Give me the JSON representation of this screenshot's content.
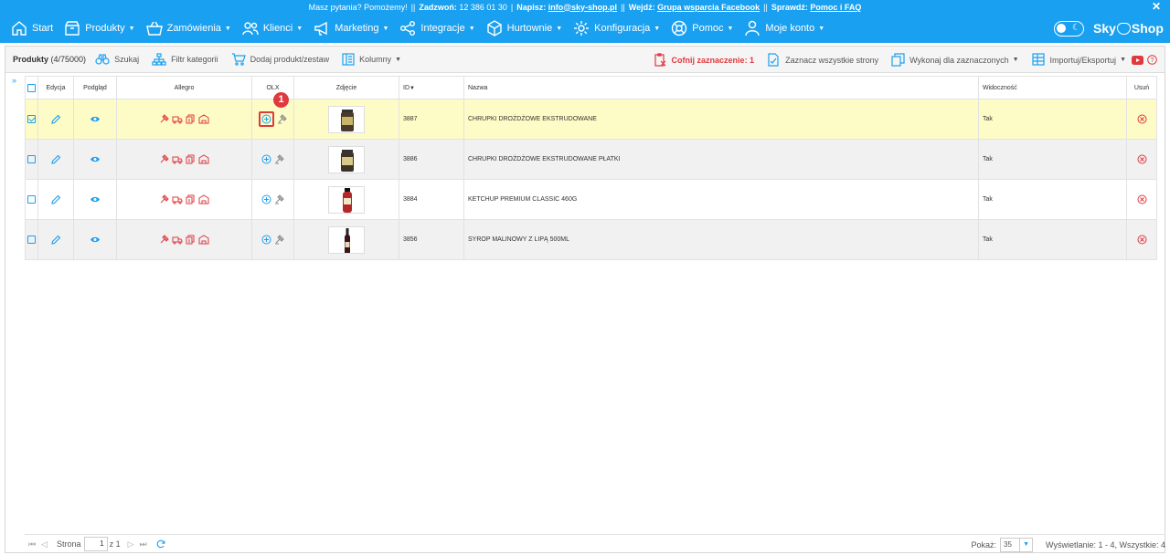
{
  "topbar": {
    "question": "Masz pytania? Pomożemy!",
    "call_label": "Zadzwoń:",
    "call_number": "12 386 01 30",
    "write_label": "Napisz:",
    "email": "info@sky-shop.pl",
    "join_label": "Wejdź:",
    "facebook_link": "Grupa wsparcia Facebook",
    "check_label": "Sprawdź:",
    "help_link": "Pomoc i FAQ",
    "separator": "||"
  },
  "nav": {
    "items": [
      {
        "label": "Start",
        "icon": "home-icon"
      },
      {
        "label": "Produkty",
        "icon": "box-icon"
      },
      {
        "label": "Zamówienia",
        "icon": "basket-icon"
      },
      {
        "label": "Klienci",
        "icon": "users-icon"
      },
      {
        "label": "Marketing",
        "icon": "megaphone-icon"
      },
      {
        "label": "Integracje",
        "icon": "share-icon"
      },
      {
        "label": "Hurtownie",
        "icon": "cube-icon"
      },
      {
        "label": "Konfiguracja",
        "icon": "gear-icon"
      },
      {
        "label": "Pomoc",
        "icon": "lifebuoy-icon"
      },
      {
        "label": "Moje konto",
        "icon": "user-icon"
      }
    ],
    "logo_left": "Sky",
    "logo_right": "Shop"
  },
  "toolbar": {
    "title": "Produkty",
    "count": "(4/75000)",
    "search": "Szukaj",
    "category_filter": "Filtr kategorii",
    "add_product": "Dodaj produkt/zestaw",
    "columns": "Kolumny",
    "undo_selection": "Cofnij zaznaczenie: 1",
    "select_all_pages": "Zaznacz wszystkie strony",
    "do_for_selected": "Wykonaj dla zaznaczonych",
    "import_export": "Importuj/Eksportuj"
  },
  "table": {
    "headers": {
      "edit": "Edycja",
      "preview": "Podgląd",
      "allegro": "Allegro",
      "olx": "OLX",
      "photo": "Zdjęcie",
      "id": "ID",
      "name": "Nazwa",
      "visibility": "Widoczność",
      "delete": "Usuń"
    },
    "rows": [
      {
        "id": "3887",
        "name": "CHRUPKI DROŻDŻOWE EKSTRUDOWANE",
        "visibility": "Tak",
        "selected": true
      },
      {
        "id": "3886",
        "name": "CHRUPKI DROŻDŻOWE EKSTRUDOWANE PŁATKI",
        "visibility": "Tak",
        "selected": false
      },
      {
        "id": "3884",
        "name": "KETCHUP PREMIUM CLASSIC 460G",
        "visibility": "Tak",
        "selected": false
      },
      {
        "id": "3856",
        "name": "SYROP MALINOWY Z LIPĄ 500ML",
        "visibility": "Tak",
        "selected": false
      }
    ]
  },
  "annotation": {
    "badge": "1"
  },
  "footer": {
    "page_label": "Strona",
    "page_value": "1",
    "page_of": "z 1",
    "show_label": "Pokaż:",
    "show_value": "35",
    "display_info": "Wyświetlanie: 1 - 4, Wszystkie: 4"
  },
  "colors": {
    "accent": "#1aa0f0",
    "danger": "#e0393e",
    "selected_row": "#fefcc6"
  }
}
